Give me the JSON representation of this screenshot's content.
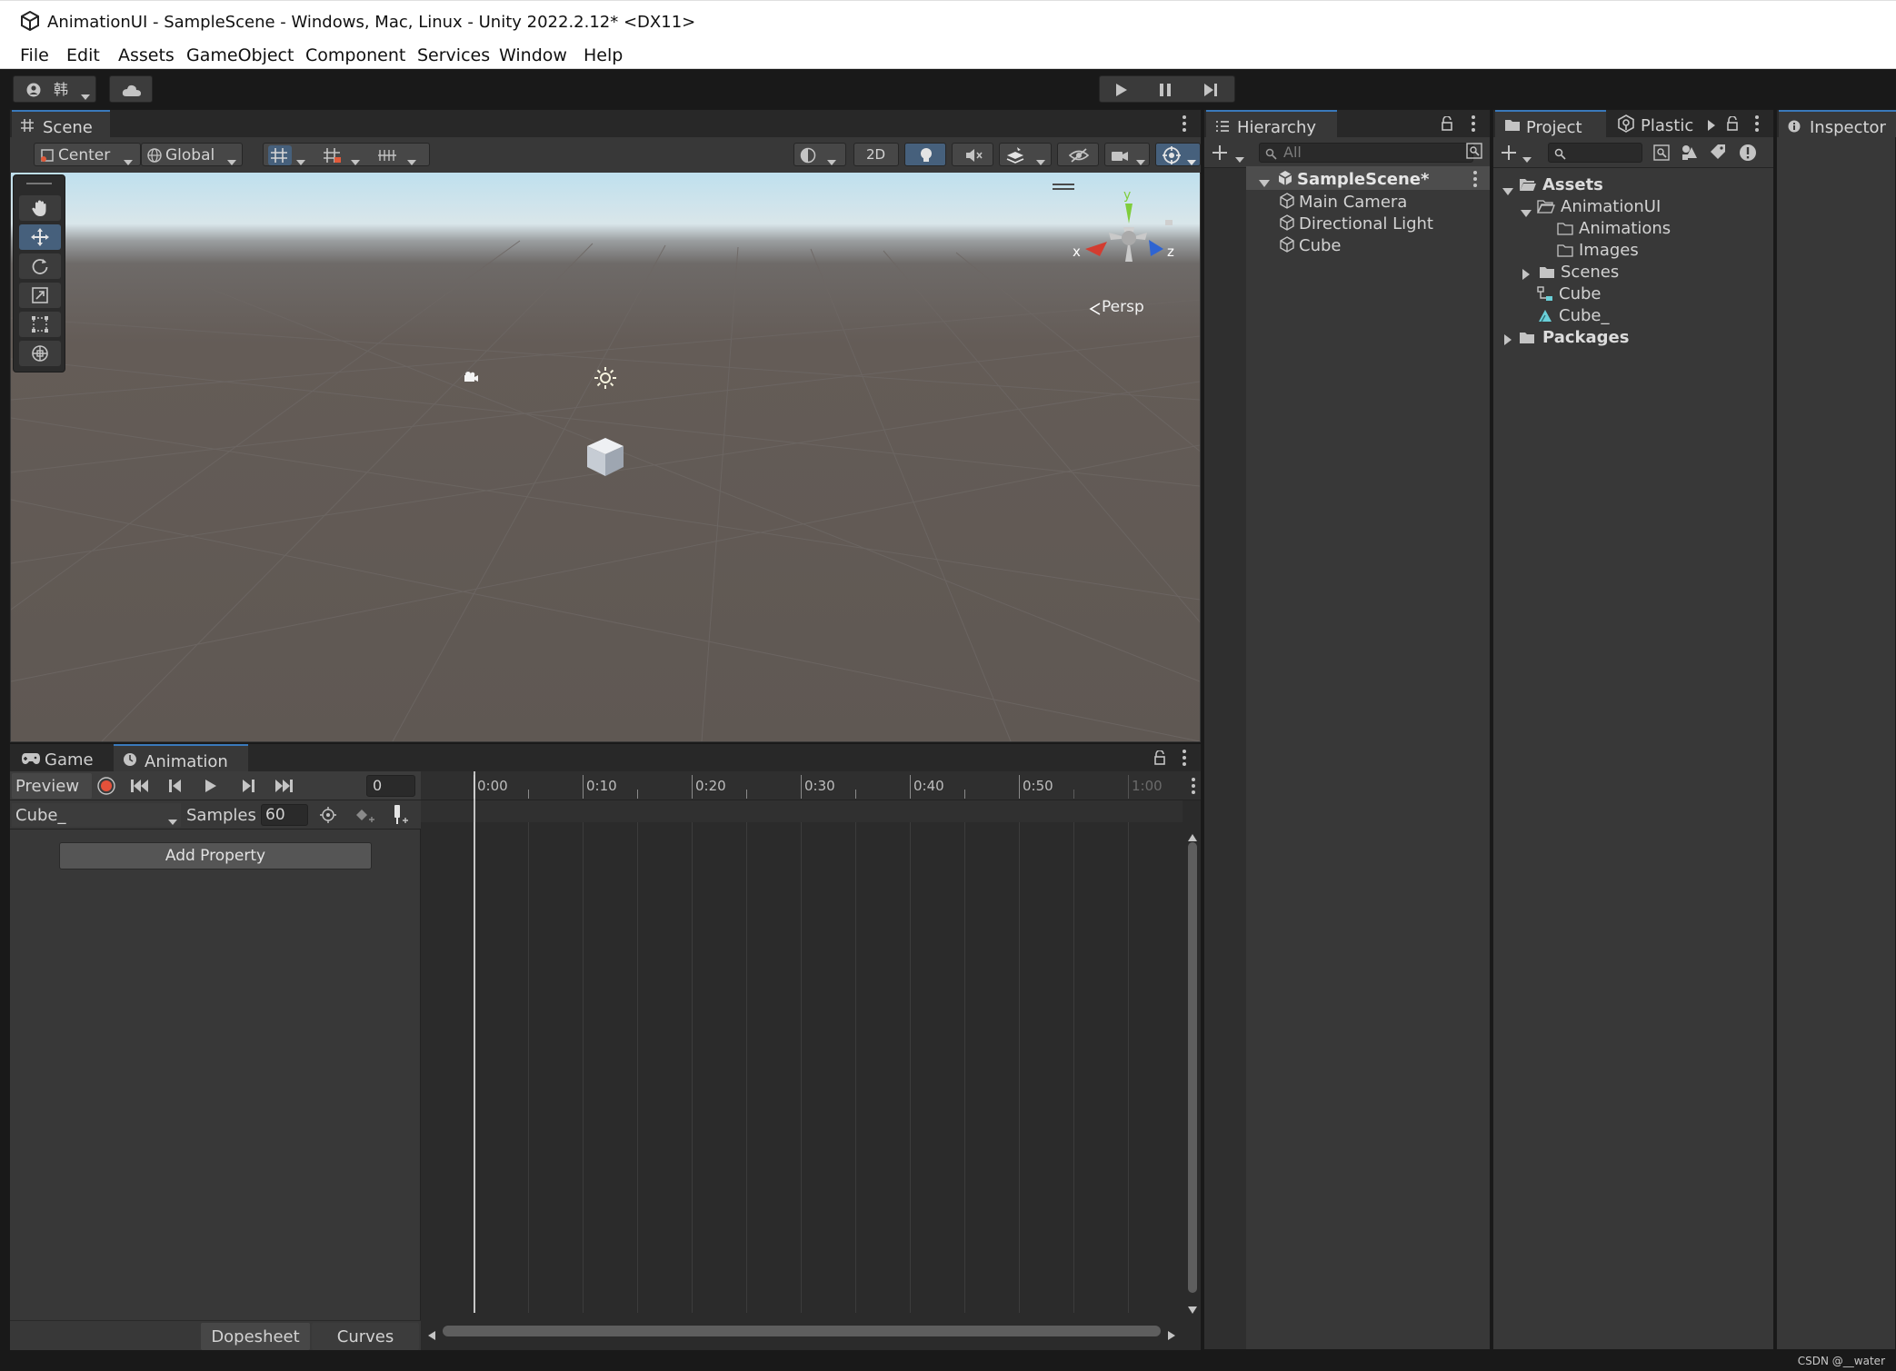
{
  "window": {
    "title": "AnimationUI - SampleScene - Windows, Mac, Linux - Unity 2022.2.12* <DX11>"
  },
  "menu": [
    "File",
    "Edit",
    "Assets",
    "GameObject",
    "Component",
    "Services",
    "Window",
    "Help"
  ],
  "toolbar": {
    "account_label": "韩"
  },
  "scene": {
    "tab_label": "Scene",
    "pivot_label": "Center",
    "space_label": "Global",
    "mode_2d_label": "2D",
    "gizmo_x": "x",
    "gizmo_y": "y",
    "gizmo_z": "z",
    "persp_label": "Persp"
  },
  "hierarchy": {
    "tab_label": "Hierarchy",
    "search_placeholder": "All",
    "scene_name": "SampleScene*",
    "items": [
      "Main Camera",
      "Directional Light",
      "Cube"
    ]
  },
  "project": {
    "tab_label": "Project",
    "plastic_label": "Plastic",
    "tree": {
      "assets": "Assets",
      "animation_ui": "AnimationUI",
      "animations": "Animations",
      "images": "Images",
      "scenes": "Scenes",
      "cube": "Cube",
      "cube_anim": "Cube_",
      "packages": "Packages"
    }
  },
  "inspector": {
    "tab_label": "Inspector"
  },
  "animation": {
    "game_tab_label": "Game",
    "anim_tab_label": "Animation",
    "preview_label": "Preview",
    "frame_value": "0",
    "clip_name": "Cube_",
    "samples_label": "Samples",
    "samples_value": "60",
    "add_property_label": "Add Property",
    "dopesheet_label": "Dopesheet",
    "curves_label": "Curves",
    "ruler_labels": [
      "0:00",
      "0:10",
      "0:20",
      "0:30",
      "0:40",
      "0:50",
      "1:00"
    ]
  },
  "watermark": "CSDN @__water"
}
